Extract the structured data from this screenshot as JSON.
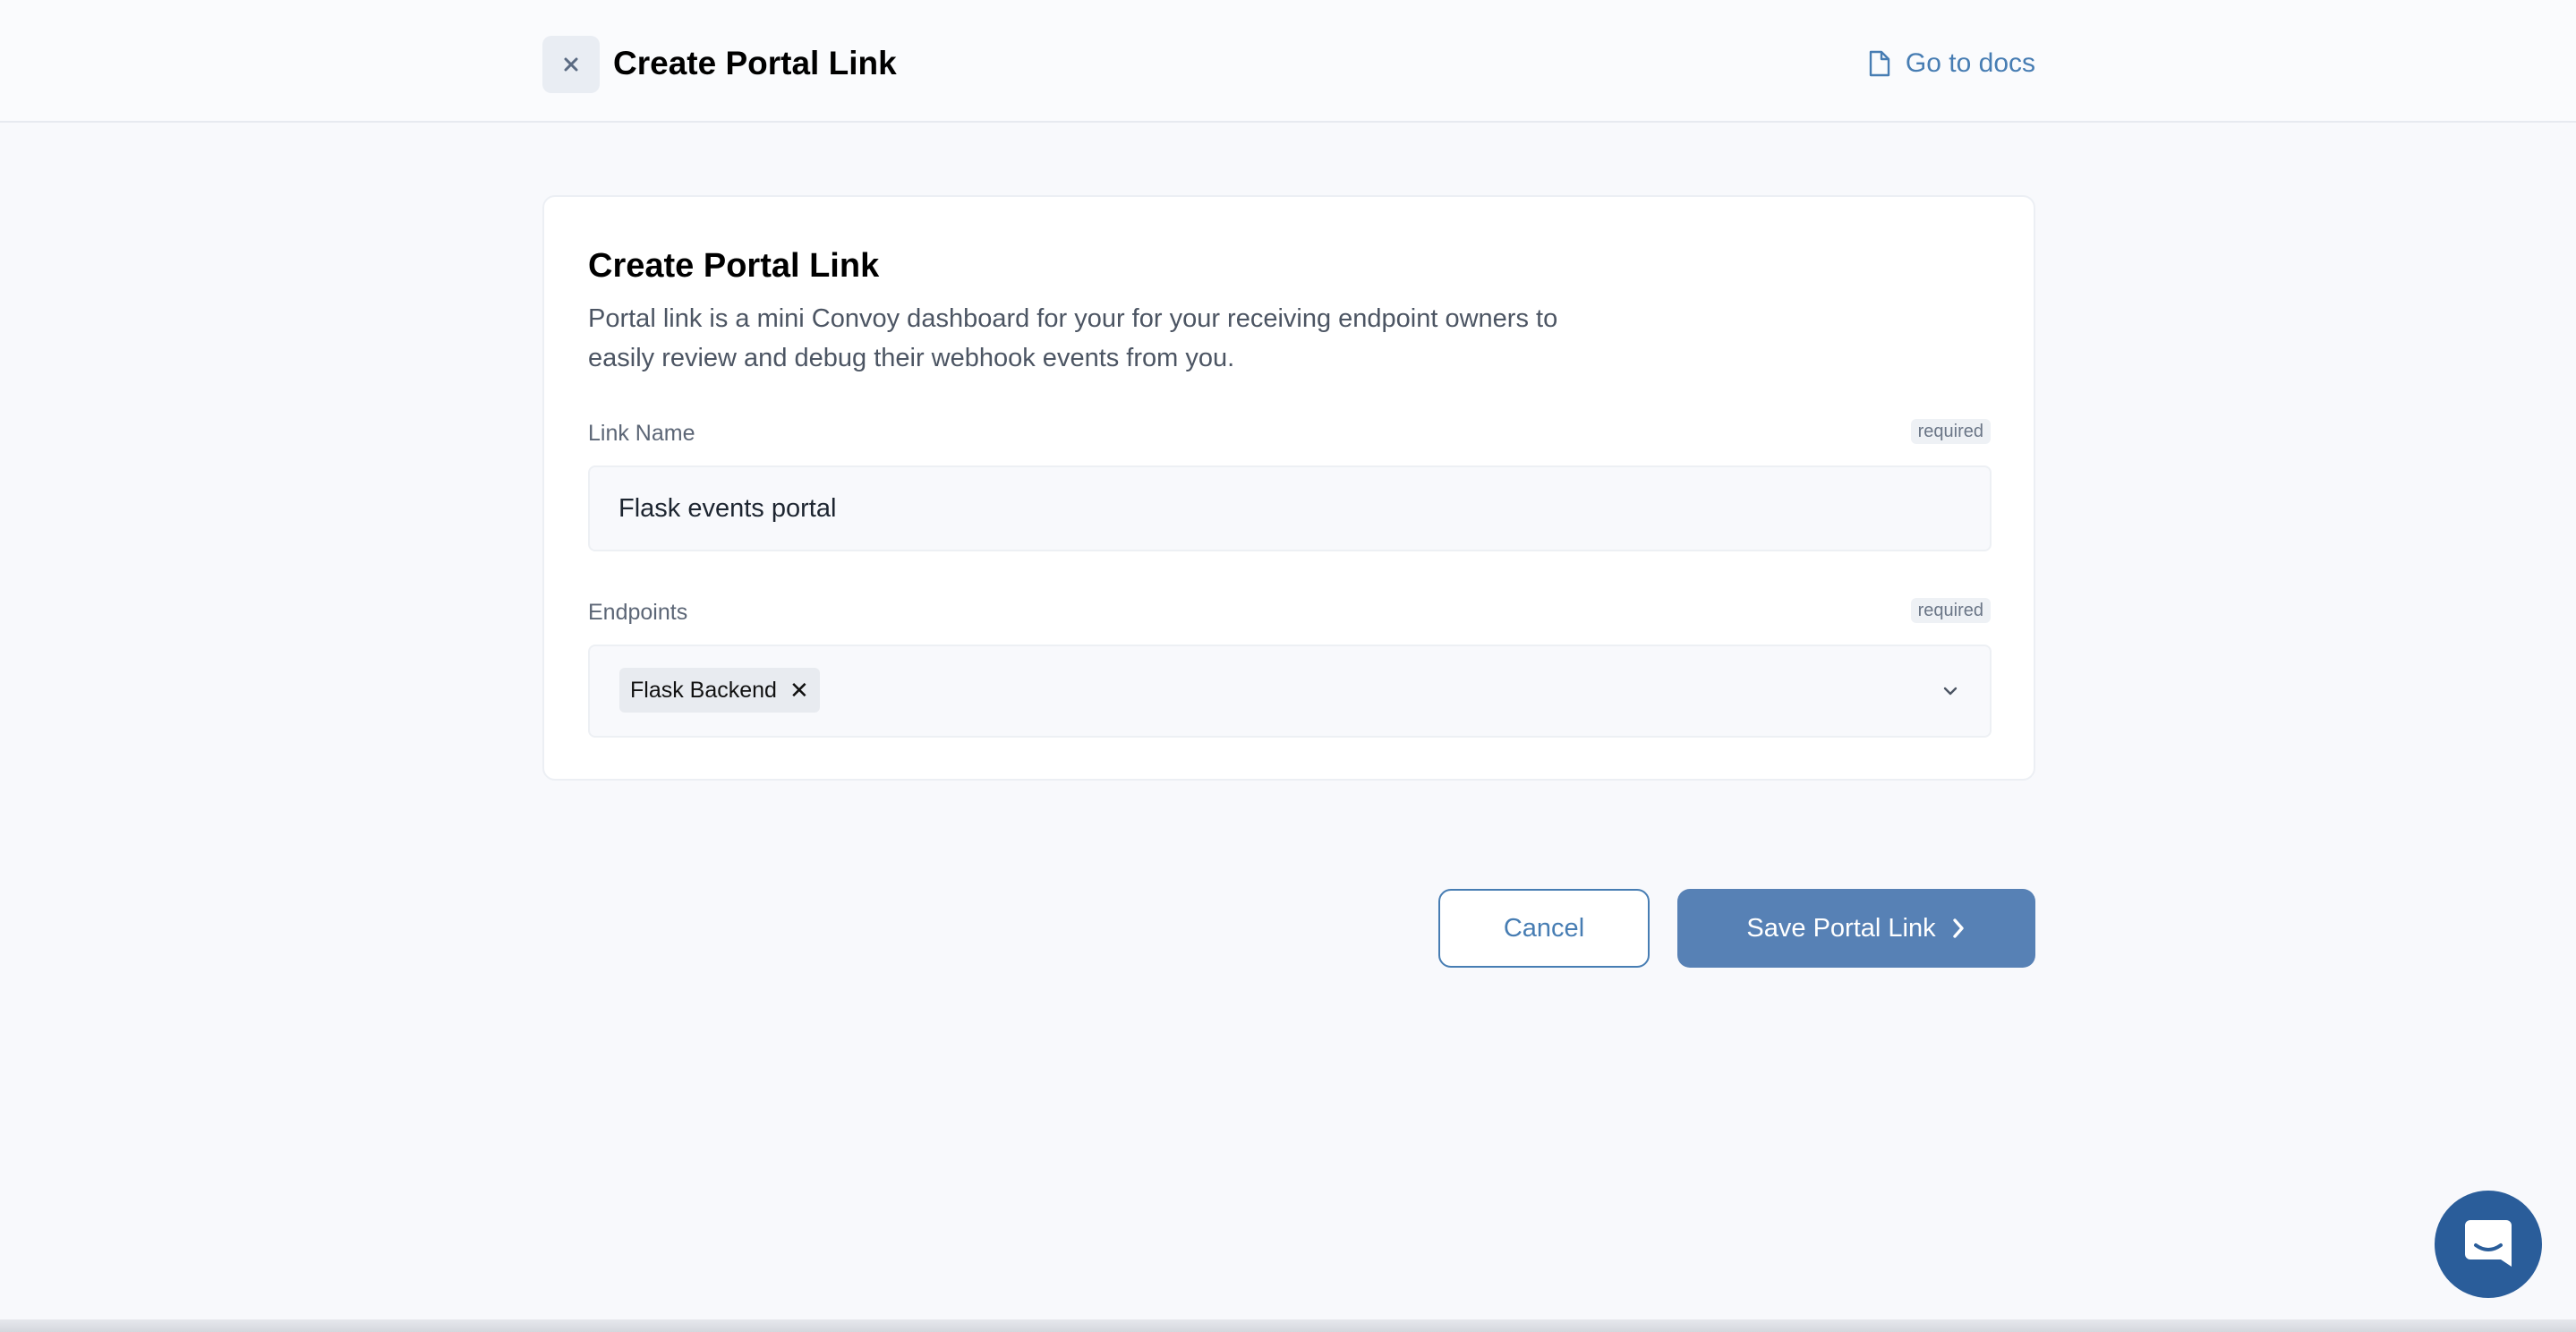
{
  "header": {
    "title": "Create Portal Link",
    "docs_link": "Go to docs"
  },
  "form": {
    "title": "Create Portal Link",
    "description": "Portal link is a mini Convoy dashboard for your for your receiving endpoint owners to easily review and debug their webhook events from you.",
    "link_name": {
      "label": "Link Name",
      "badge": "required",
      "value": "Flask events portal"
    },
    "endpoints": {
      "label": "Endpoints",
      "badge": "required",
      "selected": [
        "Flask Backend"
      ]
    }
  },
  "actions": {
    "cancel_label": "Cancel",
    "save_label": "Save Portal Link"
  },
  "colors": {
    "accent": "#477db3",
    "primary_button": "#5781b5",
    "chat_button": "#2a5d9a"
  },
  "icons": [
    "close-icon",
    "document-icon",
    "chip-remove-icon",
    "chevron-down-icon",
    "chevron-right-icon",
    "chat-icon"
  ]
}
